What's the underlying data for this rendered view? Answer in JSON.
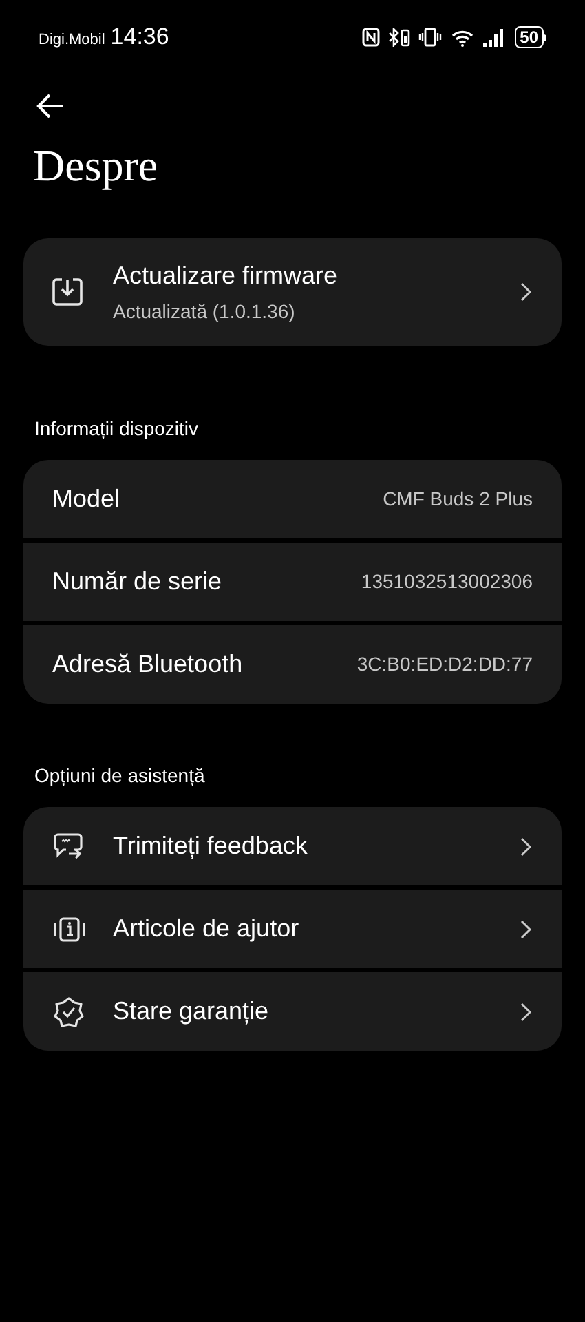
{
  "status_bar": {
    "carrier": "Digi.Mobil",
    "time": "14:36",
    "battery": "50"
  },
  "header": {
    "title": "Despre"
  },
  "firmware": {
    "title": "Actualizare firmware",
    "subtitle": "Actualizată (1.0.1.36)"
  },
  "device_info": {
    "heading": "Informații dispozitiv",
    "rows": [
      {
        "label": "Model",
        "value": "CMF Buds 2 Plus"
      },
      {
        "label": "Număr de serie",
        "value": "1351032513002306"
      },
      {
        "label": "Adresă Bluetooth",
        "value": "3C:B0:ED:D2:DD:77"
      }
    ]
  },
  "support": {
    "heading": "Opțiuni de asistență",
    "items": [
      {
        "label": "Trimiteți feedback"
      },
      {
        "label": "Articole de ajutor"
      },
      {
        "label": "Stare garanție"
      }
    ]
  }
}
